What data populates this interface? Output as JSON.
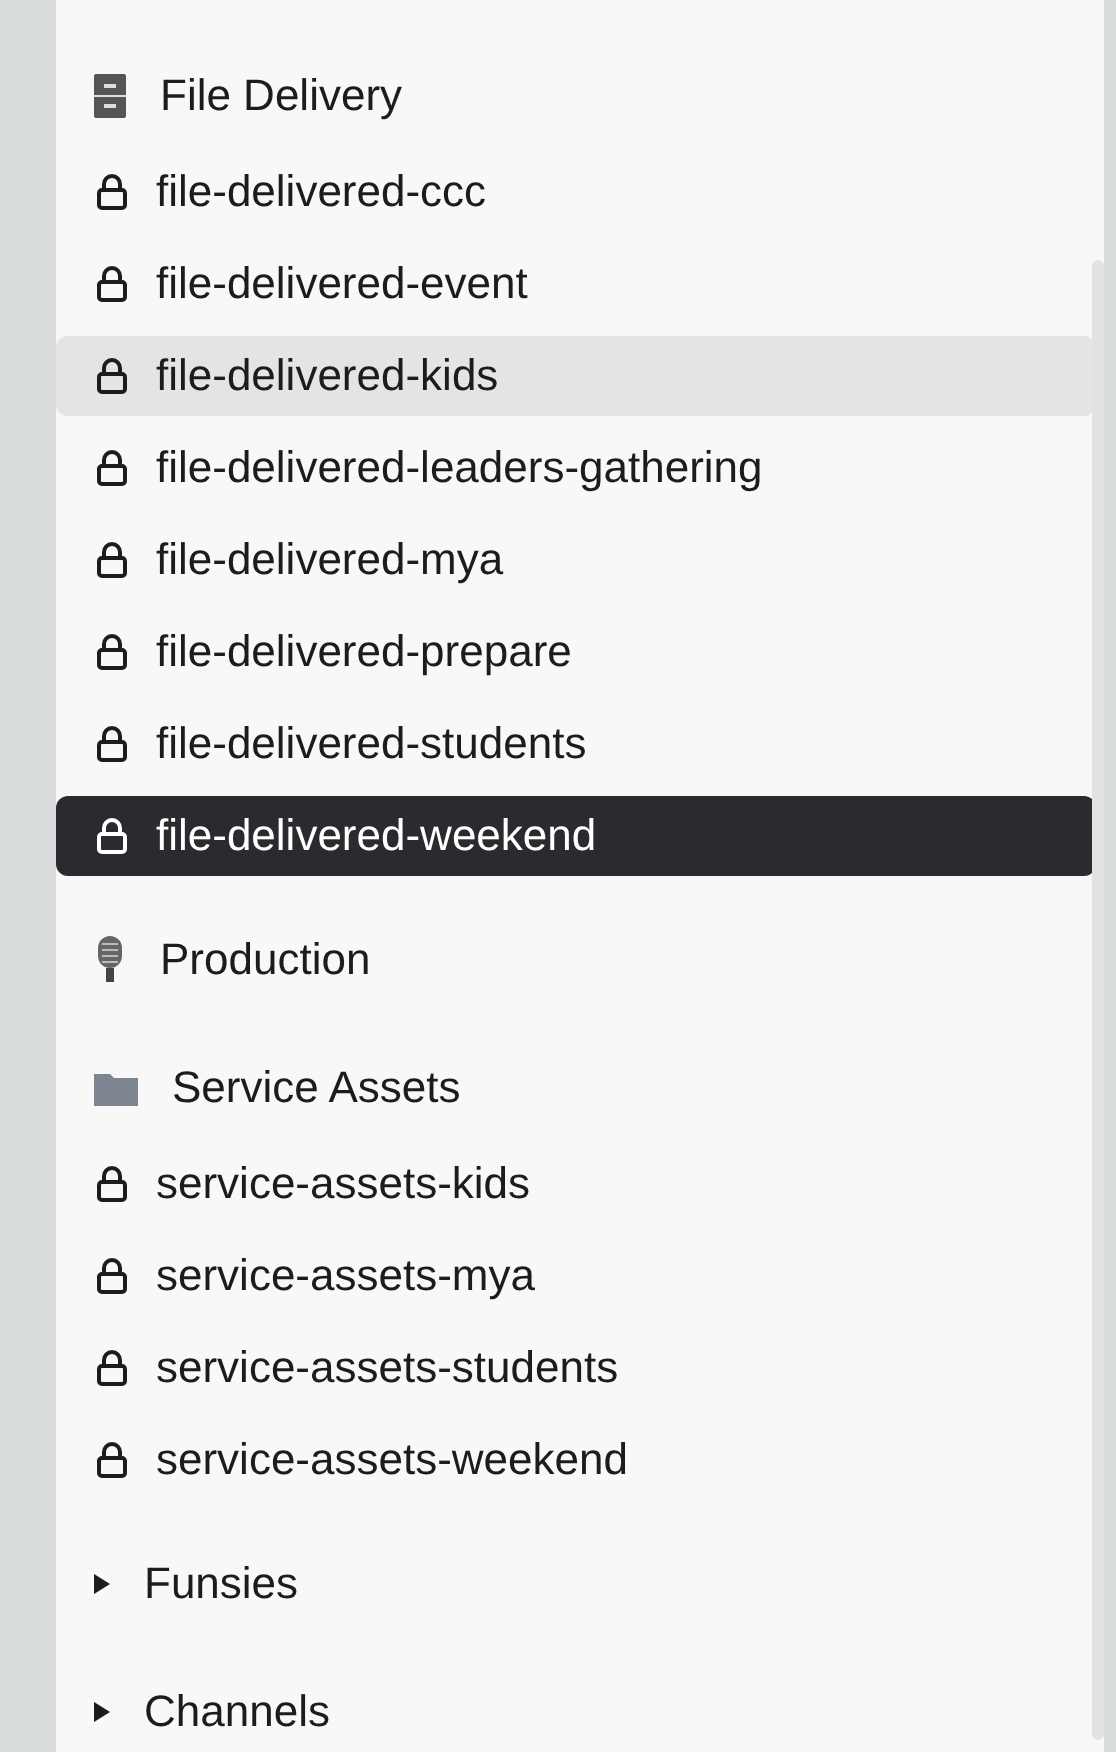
{
  "sections": [
    {
      "title": "File Delivery",
      "kind": "cabinet",
      "channels": [
        {
          "name": "file-delivered-ccc",
          "selected": false,
          "hovered": false
        },
        {
          "name": "file-delivered-event",
          "selected": false,
          "hovered": false
        },
        {
          "name": "file-delivered-kids",
          "selected": false,
          "hovered": true
        },
        {
          "name": "file-delivered-leaders-gathering",
          "selected": false,
          "hovered": false
        },
        {
          "name": "file-delivered-mya",
          "selected": false,
          "hovered": false
        },
        {
          "name": "file-delivered-prepare",
          "selected": false,
          "hovered": false
        },
        {
          "name": "file-delivered-students",
          "selected": false,
          "hovered": false
        },
        {
          "name": "file-delivered-weekend",
          "selected": true,
          "hovered": false
        }
      ]
    },
    {
      "title": "Production",
      "kind": "microphone"
    },
    {
      "title": "Service Assets",
      "kind": "folder",
      "channels": [
        {
          "name": "service-assets-kids",
          "selected": false,
          "hovered": false
        },
        {
          "name": "service-assets-mya",
          "selected": false,
          "hovered": false
        },
        {
          "name": "service-assets-students",
          "selected": false,
          "hovered": false
        },
        {
          "name": "service-assets-weekend",
          "selected": false,
          "hovered": false
        }
      ]
    },
    {
      "title": "Funsies",
      "kind": "collapsed"
    },
    {
      "title": "Channels",
      "kind": "collapsed"
    }
  ]
}
